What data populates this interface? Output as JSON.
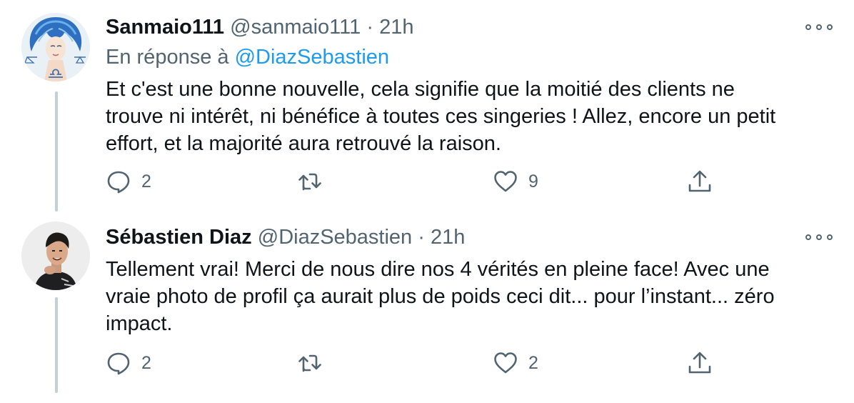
{
  "tweets": [
    {
      "name": "Sanmaio111",
      "handle": "@sanmaio111",
      "separator": "·",
      "time": "21h",
      "reply_prefix": "En réponse à",
      "reply_to": "@DiazSebastien",
      "text_lines": [
        "Et c'est une bonne nouvelle, cela signifie que la moitié des clients ne",
        "trouve ni intérêt, ni bénéfice à toutes ces singeries ! Allez, encore un petit",
        "effort, et la majorité aura retrouvé la raison."
      ],
      "reply_count": "2",
      "like_count": "9",
      "avatar_icon": "zodiac-libra-avatar"
    },
    {
      "name": "Sébastien Diaz",
      "handle": "@DiazSebastien",
      "separator": "·",
      "time": "21h",
      "text_lines": [
        "Tellement vrai! Merci de nous dire nos 4 vérités en pleine face! Avec une",
        "vraie photo de profil ça aurait plus de poids ceci dit... pour l’instant... zéro",
        "impact."
      ],
      "reply_count": "2",
      "like_count": "2",
      "avatar_icon": "profile-photo-avatar"
    }
  ],
  "icons": {
    "reply": "speech-bubble-icon",
    "retweet": "retweet-arrows-icon",
    "like": "heart-icon",
    "share": "share-upload-icon",
    "more": "more-dots-icon"
  },
  "colors": {
    "text": "#0f1419",
    "secondary": "#536471",
    "link": "#1d9bf0",
    "thread_line": "#c4cfd6"
  }
}
